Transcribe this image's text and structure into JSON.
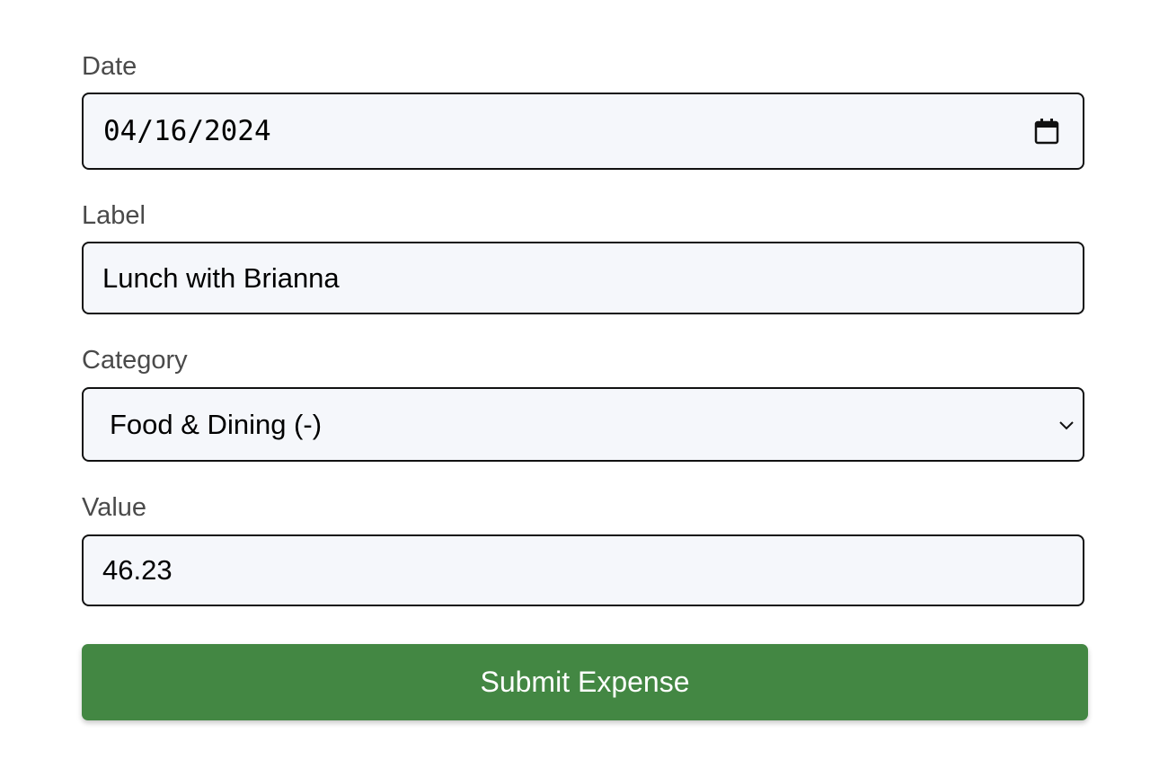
{
  "form": {
    "date": {
      "label": "Date",
      "value": "04/16/2024",
      "icon": "calendar-icon"
    },
    "label_field": {
      "label": "Label",
      "value": "Lunch with Brianna"
    },
    "category": {
      "label": "Category",
      "selected": "Food & Dining (-)",
      "icon": "chevron-down-icon"
    },
    "value_field": {
      "label": "Value",
      "value": "46.23"
    },
    "submit_label": "Submit Expense"
  },
  "colors": {
    "field_background": "#f5f7fb",
    "field_border": "#111111",
    "label_text": "#4a4a4a",
    "button_background": "#438743",
    "button_text": "#ffffff"
  }
}
